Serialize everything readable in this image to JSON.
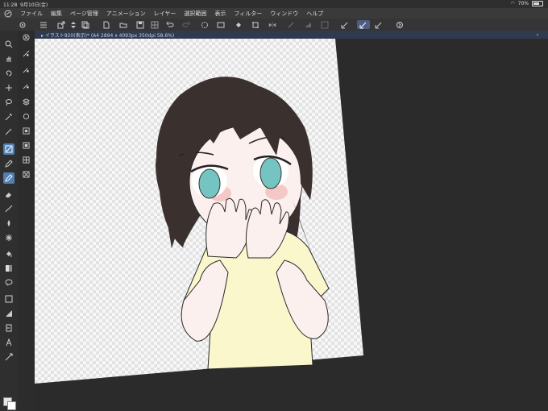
{
  "status": {
    "time": "11:28",
    "date": "9月10日(金)",
    "battery": "70%"
  },
  "menu": [
    "ファイル",
    "編集",
    "ページ管理",
    "アニメーション",
    "レイヤー",
    "選択範囲",
    "表示",
    "フィルター",
    "ウィンドウ",
    "ヘルプ"
  ],
  "document": {
    "tab_title": "イラスト920(表示)* (A4 2894 x 4093px 350dpi 58.6%)"
  },
  "colors": {
    "accent": "#4f7fb3",
    "canvas_bg": "#2b2b2b",
    "paper": "#f2f2f2",
    "shirt": "#fbf7cc",
    "hair": "#3b3230",
    "eyes": "#72c4c0",
    "skin": "#fbf0ee"
  },
  "tools": [
    "zoom-icon",
    "hand-icon",
    "rotate-view-icon",
    "move-icon",
    "lasso-select-icon",
    "magic-wand-icon",
    "eyedropper-icon",
    "operation-icon",
    "pen-icon",
    "pencil-icon",
    "brush-icon",
    "eraser-icon",
    "fill-icon",
    "gradient-icon",
    "figure-icon",
    "frame-icon",
    "ruler-icon",
    "text-icon",
    "balloon-icon",
    "line-correction-icon"
  ]
}
